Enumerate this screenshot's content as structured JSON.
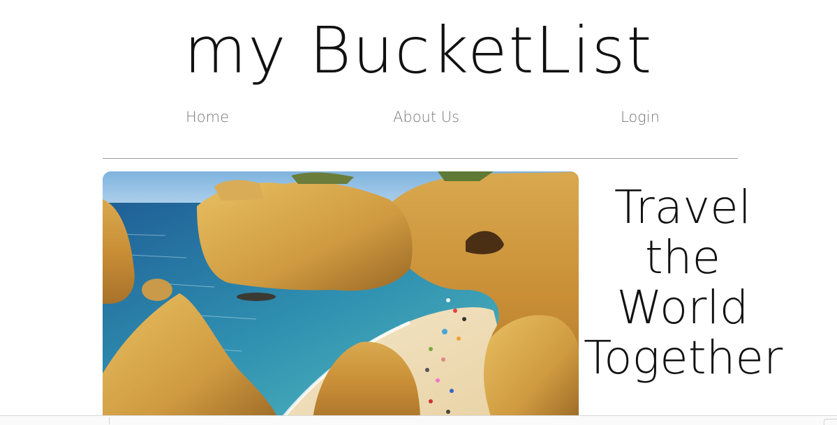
{
  "header": {
    "site_title": "my BucketList"
  },
  "nav": {
    "items": [
      {
        "label": "Home"
      },
      {
        "label": "About Us"
      },
      {
        "label": "Login"
      }
    ]
  },
  "hero": {
    "image_subject": "coastal beach cove with golden cliffs",
    "tagline_lines": [
      "Travel",
      "the",
      "World",
      "Together"
    ]
  },
  "colors": {
    "title_text": "#111111",
    "nav_text": "#777777",
    "divider": "#9a9a9a",
    "background": "#ffffff"
  }
}
